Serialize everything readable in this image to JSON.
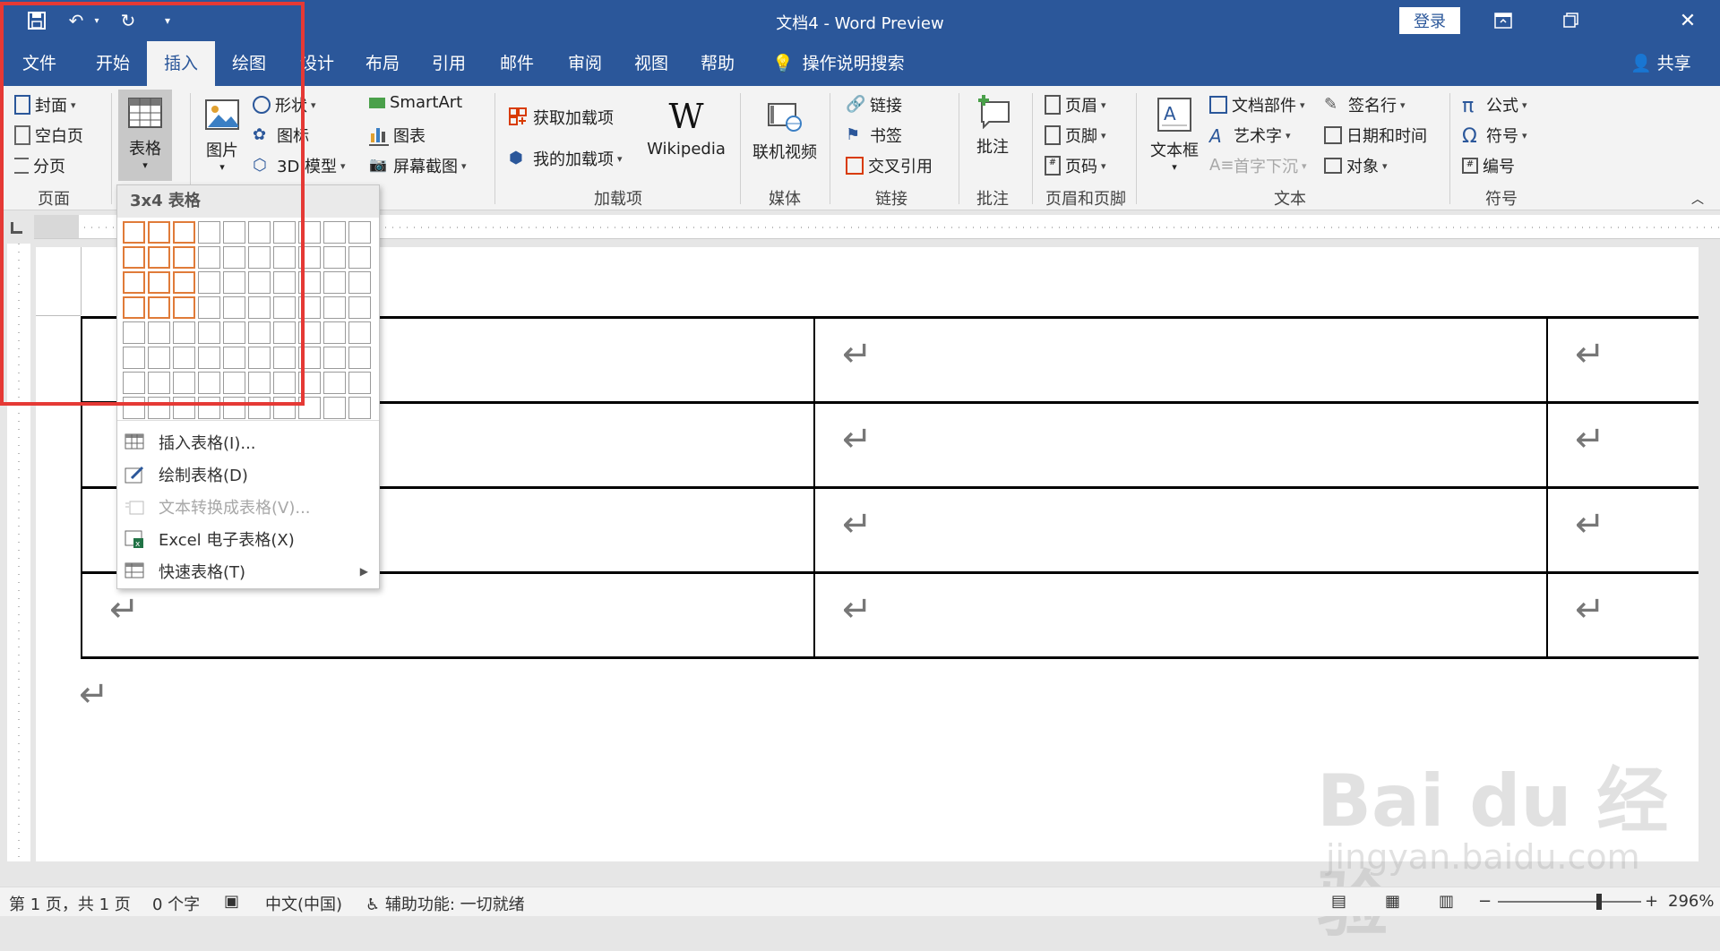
{
  "window": {
    "title": "文档4  -  Word Preview",
    "login_label": "登录"
  },
  "tabs": [
    {
      "label": "文件"
    },
    {
      "label": "开始"
    },
    {
      "label": "插入"
    },
    {
      "label": "绘图"
    },
    {
      "label": "设计"
    },
    {
      "label": "布局"
    },
    {
      "label": "引用"
    },
    {
      "label": "邮件"
    },
    {
      "label": "审阅"
    },
    {
      "label": "视图"
    },
    {
      "label": "帮助"
    }
  ],
  "tell_me": "操作说明搜索",
  "share": "共享",
  "ribbon": {
    "pages": {
      "cover": "封面",
      "blank": "空白页",
      "break": "分页",
      "label": "页面"
    },
    "table": {
      "label": "表格"
    },
    "illus": {
      "picture": "图片",
      "shapes": "形状",
      "icons": "图标",
      "model3d": "3D 模型",
      "smartart": "SmartArt",
      "chart": "图表",
      "screenshot": "屏幕截图"
    },
    "addins": {
      "get": "获取加载项",
      "my": "我的加载项",
      "wiki": "Wikipedia",
      "label": "加载项"
    },
    "media": {
      "video": "联机视频",
      "label": "媒体"
    },
    "links": {
      "link": "链接",
      "bookmark": "书签",
      "xref": "交叉引用",
      "label": "链接"
    },
    "comments": {
      "comment": "批注",
      "label": "批注"
    },
    "hf": {
      "header": "页眉",
      "footer": "页脚",
      "pagenum": "页码",
      "label": "页眉和页脚"
    },
    "text": {
      "textbox": "文本框",
      "quickparts": "文档部件",
      "wordart": "艺术字",
      "dropcap": "首字下沉",
      "sigline": "签名行",
      "datetime": "日期和时间",
      "object": "对象",
      "label": "文本"
    },
    "symbols": {
      "equation": "公式",
      "symbol": "符号",
      "number": "编号",
      "label": "符号"
    }
  },
  "dropdown": {
    "title": "3x4 表格",
    "grid_cols": 10,
    "grid_rows": 8,
    "selected_cols": 3,
    "selected_rows": 4,
    "items": {
      "insert": "插入表格(I)...",
      "draw": "绘制表格(D)",
      "convert": "文本转换成表格(V)...",
      "excel": "Excel 电子表格(X)",
      "quick": "快速表格(T)"
    }
  },
  "status": {
    "page": "第 1 页，共 1 页",
    "words": "0 个字",
    "lang": "中文(中国)",
    "access": "辅助功能: 一切就绪",
    "zoom": "296%"
  },
  "watermark": {
    "main": "Bai du 经验",
    "sub": "jingyan.baidu.com"
  },
  "colors": {
    "brand": "#2b579a",
    "highlight": "#e53935",
    "grid_select": "#e07b39"
  }
}
